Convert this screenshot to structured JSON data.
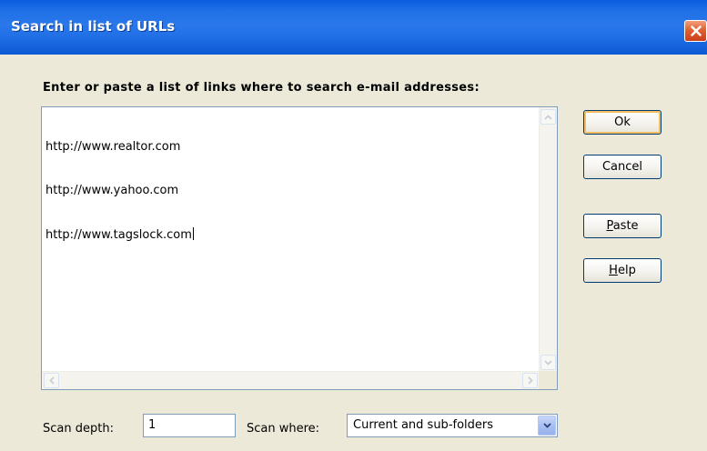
{
  "window": {
    "title": "Search in list of URLs"
  },
  "heading": "Enter or paste a list of links where to search e-mail addresses:",
  "url_list": {
    "lines": [
      "http://www.realtor.com",
      "http://www.yahoo.com",
      "http://www.tagslock.com"
    ]
  },
  "buttons": {
    "ok": "Ok",
    "cancel": "Cancel",
    "paste_mnemonic": "P",
    "paste_rest": "aste",
    "help_mnemonic": "H",
    "help_rest": "elp"
  },
  "scan_depth": {
    "label": "Scan depth:",
    "value": "1"
  },
  "scan_where": {
    "label": "Scan where:",
    "selected": "Current and sub-folders"
  },
  "icons": {
    "close": "close-icon",
    "scroll_up": "arrow-up-icon",
    "scroll_down": "arrow-down-icon",
    "scroll_left": "arrow-left-icon",
    "scroll_right": "arrow-right-icon",
    "dropdown": "chevron-down-icon"
  },
  "colors": {
    "titlebar": "#1f6ee5",
    "dialog_bg": "#ece9d8",
    "close_button": "#e26030",
    "default_button_highlight": "#f3bd62",
    "field_border": "#7f9db9"
  }
}
